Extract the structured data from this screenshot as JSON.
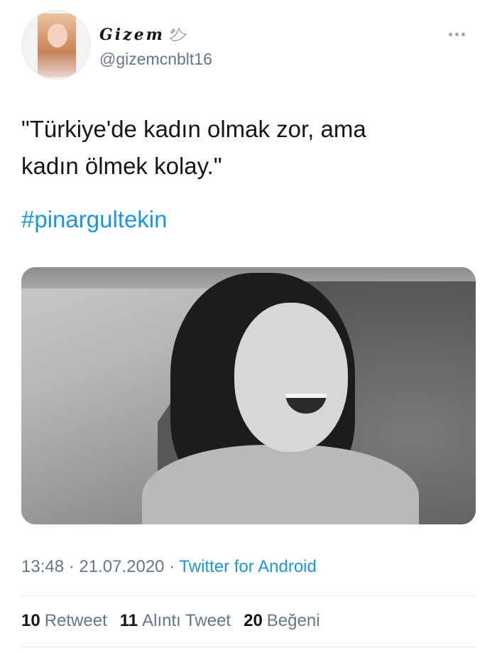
{
  "user": {
    "display_name": "Gizem",
    "handle": "@gizemcnblt16"
  },
  "tweet": {
    "text": "\"Türkiye'de kadın olmak zor, ama\nkadın ölmek kolay.\"",
    "hashtag": "#pinargultekin"
  },
  "meta": {
    "time": "13:48",
    "separator1": " · ",
    "date": "21.07.2020",
    "separator2": " · ",
    "source": "Twitter for Android"
  },
  "stats": [
    {
      "count": "10",
      "label": "Retweet"
    },
    {
      "count": "11",
      "label": "Alıntı Tweet"
    },
    {
      "count": "20",
      "label": "Beğeni"
    }
  ],
  "colors": {
    "link": "#1b95e0",
    "secondary_text": "#657786",
    "primary_text": "#14171a"
  },
  "icons": {
    "more": "more-options-icon",
    "dove": "dove-icon"
  }
}
